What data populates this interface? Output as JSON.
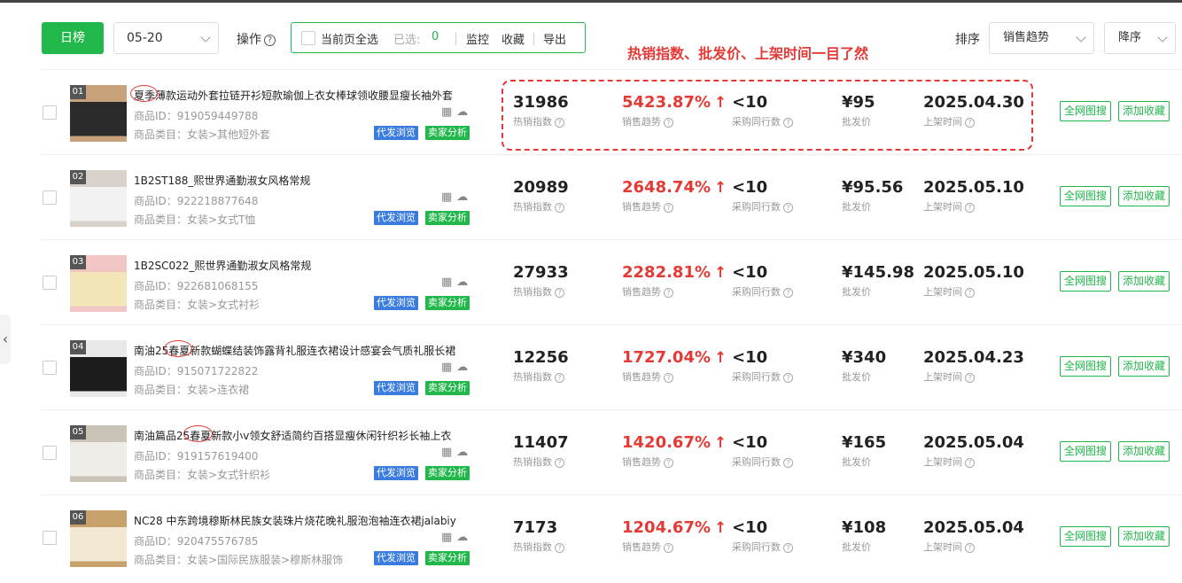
{
  "toolbar": {
    "daily_label": "日榜",
    "date_value": "05-20",
    "op_label": "操作",
    "select_all_label": "当前页全选",
    "selected_label": "已选:",
    "selected_count": "0",
    "monitor_label": "监控",
    "favorite_label": "收藏",
    "export_label": "导出",
    "sort_label": "排序",
    "sort_value": "销售趋势",
    "order_value": "降序"
  },
  "annotation": "热销指数、批发价、上架时间一目了然",
  "labels": {
    "id_prefix": "商品ID：",
    "cat_prefix": "商品类目：",
    "hot_index": "热销指数",
    "sales_trend": "销售趋势",
    "peer_count": "采购同行数",
    "wholesale": "批发价",
    "list_time": "上架时间",
    "tag_proxy": "代发浏览",
    "tag_seller": "卖家分析",
    "btn_search": "全网图搜",
    "btn_favorite": "添加收藏"
  },
  "colors": {
    "accent": "#21b74b",
    "red": "#e53935",
    "blue": "#3a7be0"
  },
  "products": [
    {
      "rank": "01",
      "title": "夏季薄款运动外套拉链开衫短款瑜伽上衣女棒球领收腰显瘦长袖外套",
      "id": "919059449788",
      "category": "女装>其他短外套",
      "hot": "31986",
      "trend": "5423.87%",
      "peers": "<10",
      "price": "¥95",
      "date": "2025.04.30"
    },
    {
      "rank": "02",
      "title": "1B2ST188_熙世界通勤淑女风格常规",
      "id": "922218877648",
      "category": "女装>女式T恤",
      "hot": "20989",
      "trend": "2648.74%",
      "peers": "<10",
      "price": "¥95.56",
      "date": "2025.05.10"
    },
    {
      "rank": "03",
      "title": "1B2SC022_熙世界通勤淑女风格常规",
      "id": "922681068155",
      "category": "女装>女式衬衫",
      "hot": "27933",
      "trend": "2282.81%",
      "peers": "<10",
      "price": "¥145.98",
      "date": "2025.05.10"
    },
    {
      "rank": "04",
      "title": "南油25春夏新款蝴蝶结装饰露背礼服连衣裙设计感宴会气质礼服长裙",
      "id": "915071722822",
      "category": "女装>连衣裙",
      "hot": "12256",
      "trend": "1727.04%",
      "peers": "<10",
      "price": "¥340",
      "date": "2025.04.23"
    },
    {
      "rank": "05",
      "title": "南油篇品25春夏新款小v领女舒适简约百搭显瘦休闲针织衫长袖上衣",
      "id": "919157619400",
      "category": "女装>女式针织衫",
      "hot": "11407",
      "trend": "1420.67%",
      "peers": "<10",
      "price": "¥165",
      "date": "2025.05.04"
    },
    {
      "rank": "06",
      "title": "NC28 中东跨境穆斯林民族女装珠片烧花晚礼服泡泡袖连衣裙jalabiy",
      "id": "920475576785",
      "category": "女装>国际民族服装>穆斯林服饰",
      "hot": "7173",
      "trend": "1204.67%",
      "peers": "<10",
      "price": "¥108",
      "date": "2025.05.04"
    }
  ]
}
